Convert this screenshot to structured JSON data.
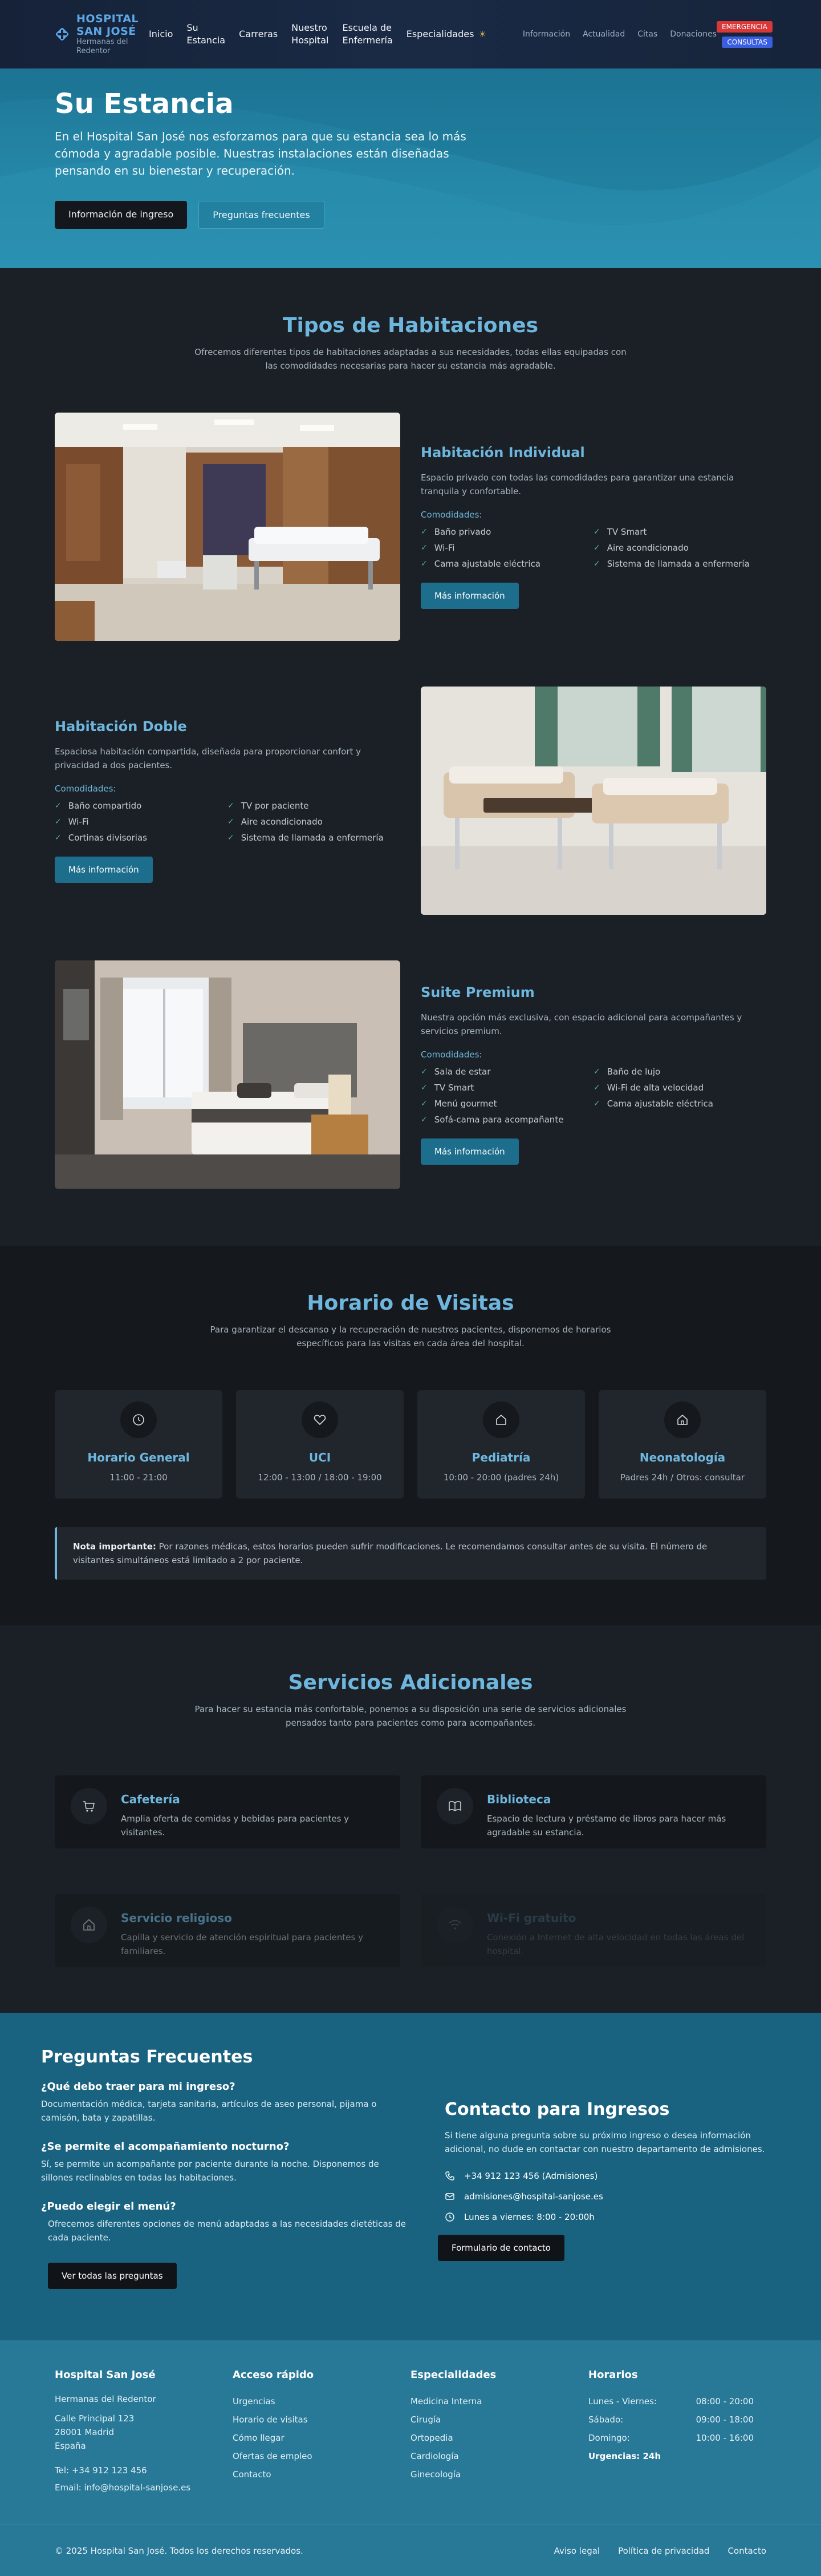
{
  "nav": {
    "logo_line1": "HOSPITAL",
    "logo_line2": "SAN JOSÉ",
    "logo_line3": "Hermanas del",
    "logo_line4": "Redentor",
    "main": [
      {
        "l1": "Inicio",
        "l2": ""
      },
      {
        "l1": "Su",
        "l2": "Estancia"
      },
      {
        "l1": "Carreras",
        "l2": ""
      },
      {
        "l1": "Nuestro",
        "l2": "Hospital"
      },
      {
        "l1": "Escuela de",
        "l2": "Enfermería"
      },
      {
        "l1": "Especialidades",
        "l2": ""
      }
    ],
    "secondary": [
      "Información",
      "Actualidad",
      "Citas",
      "Donaciones"
    ],
    "emergency": "EMERGENCIA",
    "consult": "CONSULTAS"
  },
  "hero": {
    "title": "Su Estancia",
    "text": "En el Hospital San José nos esforzamos para que su estancia sea lo más cómoda y agradable posible. Nuestras instalaciones están diseñadas pensando en su bienestar y recuperación.",
    "btn1": "Información de ingreso",
    "btn2": "Preguntas frecuentes"
  },
  "rooms": {
    "title": "Tipos de Habitaciones",
    "subtitle": "Ofrecemos diferentes tipos de habitaciones adaptadas a sus necesidades, todas ellas equipadas con las comodidades necesarias para hacer su estancia más agradable.",
    "amenities_label": "Comodidades:",
    "more": "Más información",
    "items": [
      {
        "name": "Habitación Individual",
        "desc": "Espacio privado con todas las comodidades para garantizar una estancia tranquila y confortable.",
        "amenities": [
          "Baño privado",
          "TV Smart",
          "Wi-Fi",
          "Aire acondicionado",
          "Cama ajustable eléctrica",
          "Sistema de llamada a enfermería"
        ]
      },
      {
        "name": "Habitación Doble",
        "desc": "Espaciosa habitación compartida, diseñada para proporcionar confort y privacidad a dos pacientes.",
        "amenities": [
          "Baño compartido",
          "TV por paciente",
          "Wi-Fi",
          "Aire acondicionado",
          "Cortinas divisorias",
          "Sistema de llamada a enfermería"
        ]
      },
      {
        "name": "Suite Premium",
        "desc": "Nuestra opción más exclusiva, con espacio adicional para acompañantes y servicios premium.",
        "amenities": [
          "Sala de estar",
          "Baño de lujo",
          "TV Smart",
          "Wi-Fi de alta velocidad",
          "Menú gourmet",
          "Cama ajustable eléctrica",
          "Sofá-cama para acompañante"
        ]
      }
    ]
  },
  "visits": {
    "title": "Horario de Visitas",
    "subtitle": "Para garantizar el descanso y la recuperación de nuestros pacientes, disponemos de horarios específicos para las visitas en cada área del hospital.",
    "cards": [
      {
        "icon": "clock-icon",
        "name": "Horario General",
        "time": "11:00 - 21:00"
      },
      {
        "icon": "heart-icon",
        "name": "UCI",
        "time": "12:00 - 13:00 / 18:00 - 19:00"
      },
      {
        "icon": "home-icon",
        "name": "Pediatría",
        "time": "10:00 - 20:00 (padres 24h)"
      },
      {
        "icon": "home-icon",
        "name": "Neonatología",
        "time": "Padres 24h / Otros: consultar"
      }
    ],
    "note_bold": "Nota importante:",
    "note_text": " Por razones médicas, estos horarios pueden sufrir modificaciones. Le recomendamos consultar antes de su visita. El número de visitantes simultáneos está limitado a 2 por paciente."
  },
  "services": {
    "title": "Servicios Adicionales",
    "subtitle": "Para hacer su estancia más confortable, ponemos a su disposición una serie de servicios adicionales pensados tanto para pacientes como para acompañantes.",
    "items": [
      {
        "icon": "cart-icon",
        "name": "Cafetería",
        "desc": "Amplia oferta de comidas y bebidas para pacientes y visitantes."
      },
      {
        "icon": "book-icon",
        "name": "Biblioteca",
        "desc": "Espacio de lectura y préstamo de libros para hacer más agradable su estancia."
      },
      {
        "icon": "home-icon",
        "name": "Servicio religioso",
        "desc": "Capilla y servicio de atención espiritual para pacientes y familiares."
      },
      {
        "icon": "wifi-icon",
        "name": "Wi-Fi gratuito",
        "desc": "Conexión a Internet de alta velocidad en todas las áreas del hospital."
      }
    ]
  },
  "faq": {
    "title": "Preguntas Frecuentes",
    "items": [
      {
        "q": "¿Qué debo traer para mi ingreso?",
        "a": "Documentación médica, tarjeta sanitaria, artículos de aseo personal, pijama o camisón, bata y zapatillas."
      },
      {
        "q": "¿Se permite el acompañamiento nocturno?",
        "a": "Sí, se permite un acompañante por paciente durante la noche. Disponemos de sillones reclinables en todas las habitaciones."
      },
      {
        "q": "¿Puedo elegir el menú?",
        "a": "Ofrecemos diferentes opciones de menú adaptadas a las necesidades dietéticas de cada paciente."
      }
    ],
    "all_btn": "Ver todas las preguntas"
  },
  "contact": {
    "title": "Contacto para Ingresos",
    "intro": "Si tiene alguna pregunta sobre su próximo ingreso o desea información adicional, no dude en contactar con nuestro departamento de admisiones.",
    "phone": "+34 912 123 456 (Admisiones)",
    "email": "admisiones@hospital-sanjose.es",
    "hours": "Lunes a viernes: 8:00 - 20:00h",
    "form_btn": "Formulario de contacto"
  },
  "footer": {
    "col1_title": "Hospital San José",
    "col1_org": "Hermanas del Redentor",
    "addr1": "Calle Principal 123",
    "addr2": "28001 Madrid",
    "addr3": "España",
    "tel": "Tel: +34 912 123 456",
    "email": "Email: info@hospital-sanjose.es",
    "col2_title": "Acceso rápido",
    "col2_items": [
      "Urgencias",
      "Horario de visitas",
      "Cómo llegar",
      "Ofertas de empleo",
      "Contacto"
    ],
    "col3_title": "Especialidades",
    "col3_items": [
      "Medicina Interna",
      "Cirugía",
      "Ortopedia",
      "Cardiología",
      "Ginecología"
    ],
    "col4_title": "Horarios",
    "hours": [
      {
        "day": "Lunes - Viernes:",
        "time": "08:00 - 20:00"
      },
      {
        "day": "Sábado:",
        "time": "09:00 - 18:00"
      },
      {
        "day": "Domingo:",
        "time": "10:00 - 16:00"
      }
    ],
    "urgent": "Urgencias: 24h",
    "copyright": "© 2025 Hospital San José. Todos los derechos reservados.",
    "links": [
      "Aviso legal",
      "Política de privacidad",
      "Contacto"
    ]
  }
}
